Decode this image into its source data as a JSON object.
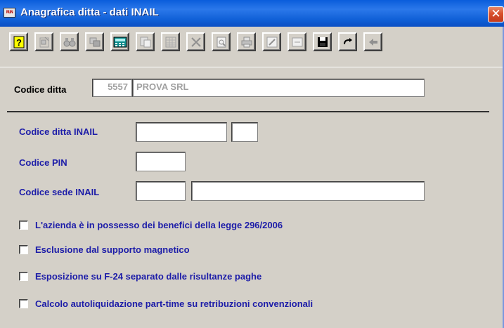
{
  "window": {
    "title": "Anagrafica ditta - dati INAIL",
    "app_icon_text": "RUN",
    "close_glyph": "✕"
  },
  "toolbar": {
    "buttons": [
      {
        "name": "help-icon"
      },
      {
        "name": "properties-icon"
      },
      {
        "name": "binoculars-search-icon"
      },
      {
        "name": "copy-records-icon"
      },
      {
        "name": "calculator-icon"
      },
      {
        "name": "paste-icon"
      },
      {
        "name": "table-grid-icon"
      },
      {
        "name": "delete-x-icon"
      },
      {
        "name": "print-preview-icon"
      },
      {
        "name": "print-icon"
      },
      {
        "name": "edit-pen-icon"
      },
      {
        "name": "form-icon"
      },
      {
        "name": "save-floppy-icon"
      },
      {
        "name": "redo-arrow-icon"
      },
      {
        "name": "back-arrow-icon"
      }
    ]
  },
  "company": {
    "label": "Codice ditta",
    "code": "5557",
    "name": "PROVA SRL"
  },
  "form": {
    "codice_ditta_inail_label": "Codice ditta INAIL",
    "codice_ditta_inail_value": "",
    "codice_ditta_inail_check": "",
    "codice_pin_label": "Codice PIN",
    "codice_pin_value": "",
    "codice_sede_label": "Codice sede INAIL",
    "codice_sede_code": "",
    "codice_sede_desc": ""
  },
  "checkboxes": [
    {
      "label": "L'azienda è in possesso dei benefici della legge 296/2006",
      "checked": false
    },
    {
      "label": "Esclusione dal supporto magnetico",
      "checked": false
    },
    {
      "label": "Esposizione su F-24 separato dalle risultanze paghe",
      "checked": false
    },
    {
      "label": "Calcolo autoliquidazione part-time su retribuzioni convenzionali",
      "checked": false
    }
  ]
}
